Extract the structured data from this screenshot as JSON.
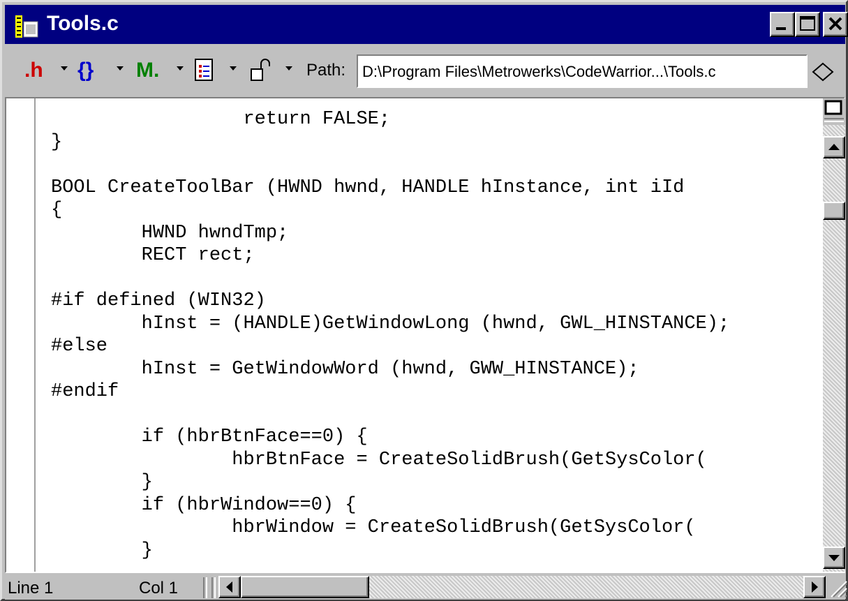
{
  "window": {
    "title": "Tools.c",
    "title_bar_color": "#000080"
  },
  "title_buttons": {
    "minimize_icon": "minimize-icon",
    "maximize_icon": "maximize-icon",
    "close_icon": "close-icon"
  },
  "toolbar": {
    "header_icon_label": ".h",
    "function_icon_label": "{}",
    "marker_icon_label": "M.",
    "header_icon_color": "#cc0000",
    "function_icon_color": "#0000cc",
    "marker_icon_color": "#008000",
    "path_label": "Path:",
    "path_value": "D:\\Program Files\\Metrowerks\\CodeWarrior...\\Tools.c"
  },
  "editor": {
    "lines": [
      "                 return FALSE;",
      "}",
      "",
      "BOOL CreateToolBar (HWND hwnd, HANDLE hInstance, int iId",
      "{",
      "        HWND hwndTmp;",
      "        RECT rect;",
      "",
      "#if defined (WIN32)",
      "        hInst = (HANDLE)GetWindowLong (hwnd, GWL_HINSTANCE);",
      "#else",
      "        hInst = GetWindowWord (hwnd, GWW_HINSTANCE);",
      "#endif",
      "",
      "        if (hbrBtnFace==0) {",
      "                hbrBtnFace = CreateSolidBrush(GetSysColor(",
      "        }",
      "        if (hbrWindow==0) {",
      "                hbrWindow = CreateSolidBrush(GetSysColor(",
      "        }"
    ]
  },
  "status": {
    "line": "Line 1",
    "col": "Col 1"
  }
}
